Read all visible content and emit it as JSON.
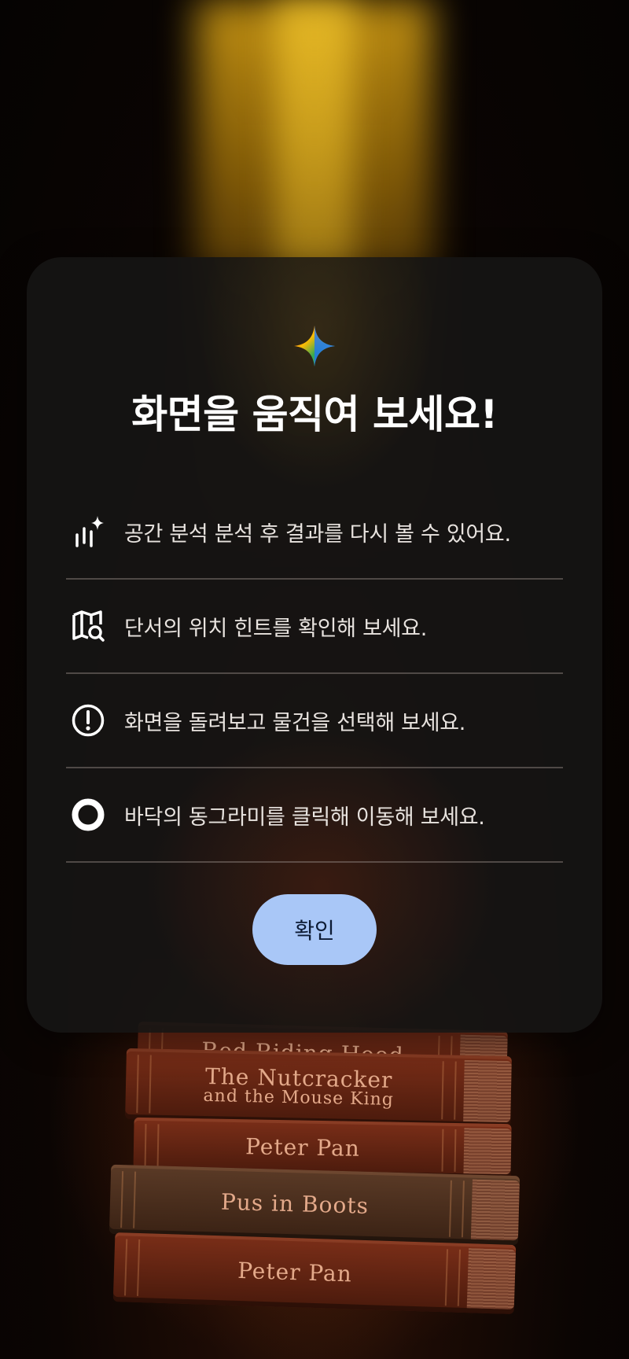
{
  "dialog": {
    "title": "화면을 움직여 보세요!",
    "items": [
      {
        "icon": "analysis-sparkle-icon",
        "label": "공간 분석 분석 후 결과를 다시 볼 수 있어요."
      },
      {
        "icon": "map-search-icon",
        "label": "단서의 위치 힌트를 확인해 보세요."
      },
      {
        "icon": "alert-circle-icon",
        "label": "화면을 돌려보고 물건을 선택해 보세요."
      },
      {
        "icon": "ring-circle-icon",
        "label": "바닥의 동그라미를 클릭해 이동해 보세요."
      }
    ],
    "confirm_label": "확인"
  },
  "background": {
    "books": [
      {
        "title": "Red Riding Hood"
      },
      {
        "title": "The Nutcracker",
        "subtitle": "and the Mouse King"
      },
      {
        "title": "Peter Pan"
      },
      {
        "title": "Pus in Boots"
      },
      {
        "title": "Peter Pan"
      }
    ]
  },
  "colors": {
    "dialog_bg": "#161413",
    "confirm_bg": "#a9c7f7",
    "spotlight": "#c89614",
    "book_spine": "#7a2e18"
  }
}
